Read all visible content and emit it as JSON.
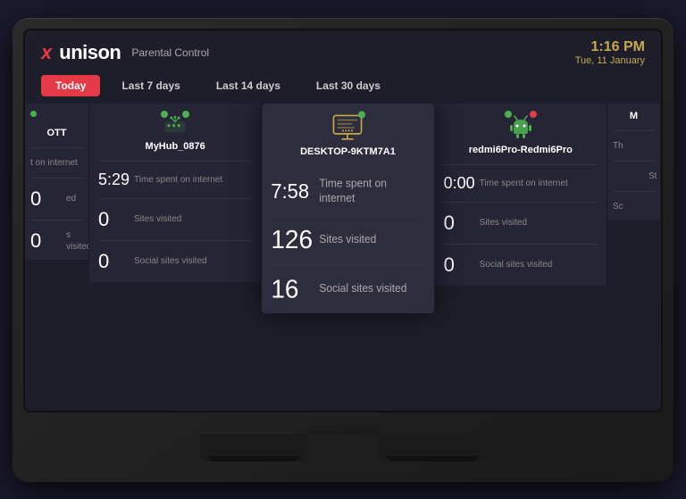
{
  "app": {
    "logo_x": "x",
    "logo_name": "unison",
    "parental_label": "Parental Control"
  },
  "clock": {
    "time": "1:16 PM",
    "date": "Tue, 11 January"
  },
  "tabs": [
    {
      "label": "Today",
      "active": true
    },
    {
      "label": "Last 7 days",
      "active": false
    },
    {
      "label": "Last 14 days",
      "active": false
    },
    {
      "label": "Last 30 days",
      "active": false
    }
  ],
  "devices": [
    {
      "id": "partial-left",
      "name": "OTT",
      "status_left": "online",
      "partial": true,
      "stats": [
        {
          "value": "",
          "label": "t on internet"
        },
        {
          "value": "0",
          "label": "ed"
        },
        {
          "value": "0",
          "label": "s visited"
        }
      ]
    },
    {
      "id": "myhub",
      "name": "MyHub_0876",
      "status_left": "online",
      "status_right": "online",
      "icon": "hub",
      "stats": [
        {
          "value": "5:29",
          "label": "Time spent on internet"
        },
        {
          "value": "0",
          "label": "Sites visited"
        },
        {
          "value": "0",
          "label": "Social sites visited"
        }
      ]
    },
    {
      "id": "desktop",
      "name": "DESKTOP-9KTM7A1",
      "status_left": "online",
      "icon": "monitor",
      "highlighted": true,
      "stats": [
        {
          "value": "7:58",
          "label": "Time spent on internet"
        },
        {
          "value": "126",
          "label": "Sites visited"
        },
        {
          "value": "16",
          "label": "Social sites visited"
        }
      ]
    },
    {
      "id": "redmi",
      "name": "redmi6Pro-Redmi6Pro",
      "status_left": "online",
      "status_right": "offline",
      "icon": "android",
      "stats": [
        {
          "value": "0:00",
          "label": "Time spent on internet"
        },
        {
          "value": "0",
          "label": "Sites visited"
        },
        {
          "value": "0",
          "label": "Social sites visited"
        }
      ]
    },
    {
      "id": "partial-right",
      "name": "M",
      "partial": true,
      "stats": [
        {
          "value": "",
          "label": "Th"
        },
        {
          "value": "",
          "label": "St"
        },
        {
          "value": "",
          "label": "Sc"
        }
      ]
    }
  ],
  "colors": {
    "accent_red": "#e63946",
    "accent_gold": "#c8a84b",
    "online_green": "#4caf50",
    "offline_red": "#e63946",
    "bg_dark": "#1e1e2a",
    "card_bg": "#252535",
    "card_highlighted": "#2d2d3d"
  }
}
